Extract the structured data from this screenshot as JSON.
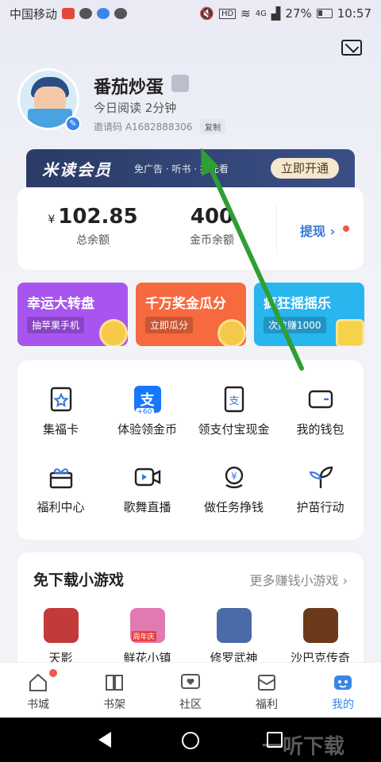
{
  "status_bar": {
    "carrier": "中国移动",
    "signal": "4G",
    "battery": "27%",
    "time": "10:57"
  },
  "profile": {
    "username": "番茄炒蛋",
    "read_today": "今日阅读 2分钟",
    "invite_code": "邀请码 A1682888306",
    "copy_label": "复制"
  },
  "vip": {
    "title": "米读会员",
    "benefits": "免广告 · 听书 · 抢先看",
    "button": "立即开通"
  },
  "wallet": {
    "currency": "¥",
    "total_value": "102.85",
    "total_label": "总余额",
    "coin_value": "400",
    "coin_label": "金币余额",
    "withdraw": "提现 ›"
  },
  "promos": [
    {
      "title": "幸运大转盘",
      "tag": "抽苹果手机",
      "color": "#a855f0"
    },
    {
      "title": "千万奖金瓜分",
      "tag": "立即瓜分",
      "color": "#f7693f"
    },
    {
      "title": "疯狂摇摇乐",
      "tag": "次数赚1000",
      "color": "#29b5ee"
    }
  ],
  "grid_items": [
    {
      "label": "集福卡",
      "icon": "card-icon"
    },
    {
      "label": "体验领金币",
      "icon": "alipay-icon"
    },
    {
      "label": "领支付宝现金",
      "icon": "alipay-phone-icon"
    },
    {
      "label": "我的钱包",
      "icon": "wallet-icon"
    },
    {
      "label": "福利中心",
      "icon": "gift-icon"
    },
    {
      "label": "歌舞直播",
      "icon": "live-icon"
    },
    {
      "label": "做任务挣钱",
      "icon": "coin-task-icon"
    },
    {
      "label": "护苗行动",
      "icon": "sprout-icon"
    }
  ],
  "alipay_badge": "+60",
  "games": {
    "title": "免下载小游戏",
    "more": "更多赚钱小游戏",
    "items": [
      {
        "label": "天影",
        "color": "#c23a3a"
      },
      {
        "label": "鲜花小镇",
        "color": "#e07ab0"
      },
      {
        "label": "修罗武神",
        "color": "#4a6aa8"
      },
      {
        "label": "沙巴克传奇",
        "color": "#6b3a1a"
      }
    ],
    "promo_badge": "周年庆"
  },
  "tabs": [
    {
      "label": "书城",
      "icon": "home-icon"
    },
    {
      "label": "书架",
      "icon": "bookshelf-icon"
    },
    {
      "label": "社区",
      "icon": "community-icon"
    },
    {
      "label": "福利",
      "icon": "welfare-icon"
    },
    {
      "label": "我的",
      "icon": "profile-icon",
      "active": true
    }
  ],
  "watermark": "一听下载",
  "colors": {
    "accent_blue": "#3a78d6",
    "arrow_green": "#2f9e35"
  }
}
